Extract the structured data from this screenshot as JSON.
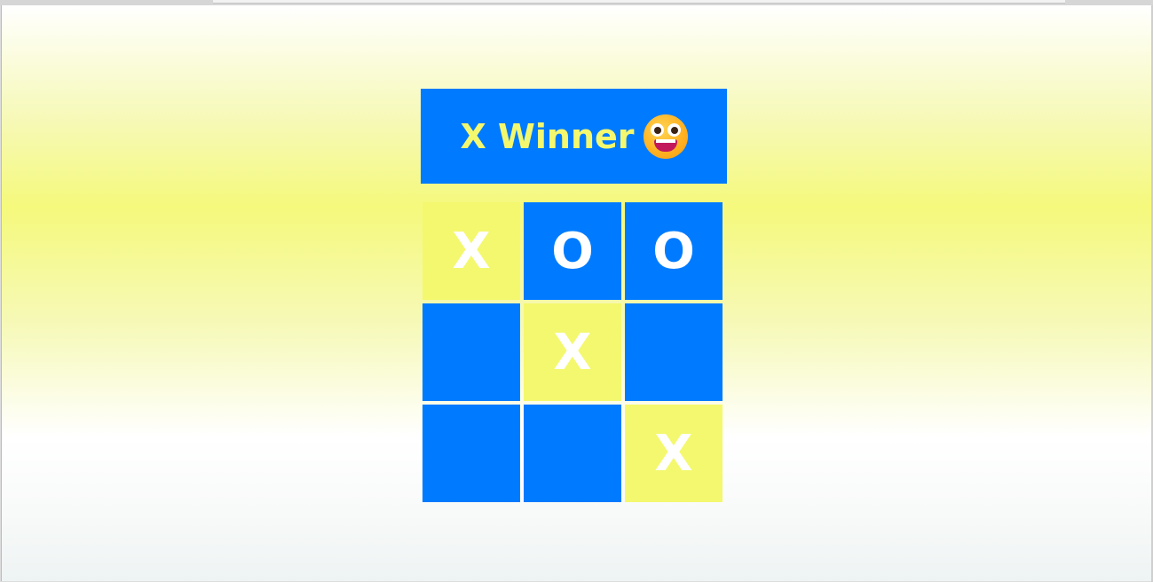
{
  "status": {
    "text": "X Winner",
    "emoji_icon": "grinning-face-icon"
  },
  "board": {
    "cells": [
      {
        "mark": "X",
        "win": true
      },
      {
        "mark": "O",
        "win": false
      },
      {
        "mark": "O",
        "win": false
      },
      {
        "mark": "",
        "win": false
      },
      {
        "mark": "X",
        "win": true
      },
      {
        "mark": "",
        "win": false
      },
      {
        "mark": "",
        "win": false
      },
      {
        "mark": "",
        "win": false
      },
      {
        "mark": "X",
        "win": true
      }
    ]
  },
  "colors": {
    "cell_default": "#007bff",
    "cell_win": "#f4f86e",
    "status_bg": "#007bff",
    "status_text": "#f4f86e",
    "mark": "#ffffff"
  }
}
